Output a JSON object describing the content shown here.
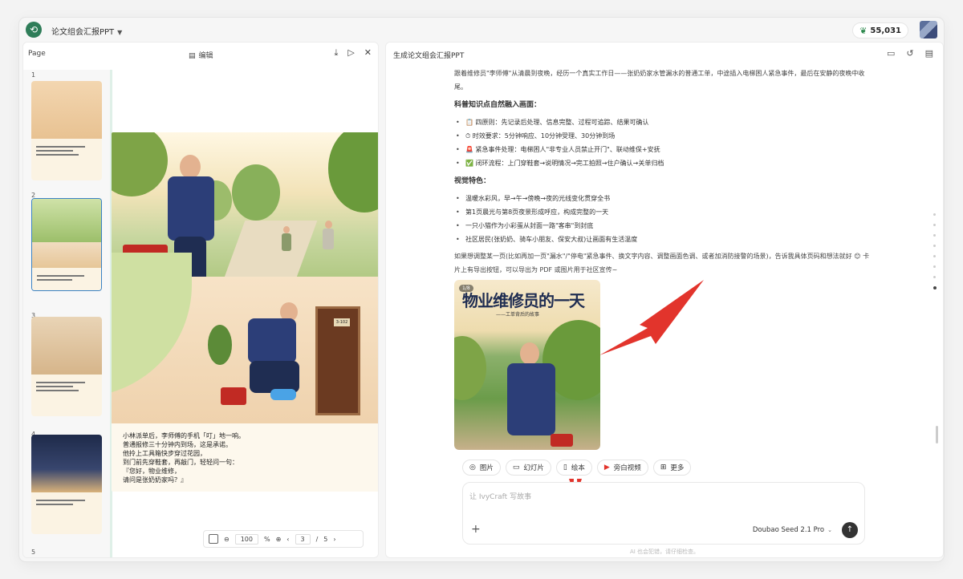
{
  "topbar": {
    "doc_name": "论文组会汇报PPT",
    "credits": "55,031"
  },
  "left": {
    "page_label": "Page",
    "edit_label": "编辑",
    "thumb_numbers": [
      "2",
      "3",
      "4",
      "5"
    ],
    "slide_text": [
      "小林派单后，李师傅的手机「叮」地一响。",
      "普通报修三十分钟内到场，这是承诺。",
      "他拎上工具箱快步穿过花园，",
      "到门前先穿鞋套，再敲门，轻轻问一句：",
      "『您好，物业维修，",
      "请问是张奶奶家吗？』"
    ],
    "door_plate": "3-102",
    "zoom": {
      "value": "100",
      "unit": "%",
      "current_page": "3",
      "separator": "/",
      "total_pages": "5"
    }
  },
  "right": {
    "title": "生成论文组会汇报PPT",
    "intro": "跟着维修员\"李师傅\"从清晨到夜晚，经历一个真实工作日——张奶奶家水管漏水的普通工单，中途插入电梯困人紧急事件，最后在安静的夜晚中收尾。",
    "section1_title": "科普知识点自然融入画面：",
    "section1_items": [
      "📋 四原则：先记录后处理、信息完整、过程可追踪、结果可确认",
      "⏱ 时效要求：5分钟响应、10分钟受理、30分钟到场",
      "🚨 紧急事件处理：电梯困人\"非专业人员禁止开门\"、联动维保+安抚",
      "✅ 闭环流程：上门穿鞋套→说明情况→完工拍照→住户确认→关单归档"
    ],
    "section2_title": "视觉特色：",
    "section2_items": [
      "温暖水彩风，早→午→傍晚→夜的光线变化贯穿全书",
      "第1页晨光与第8页夜景形成呼应，构成完整的一天",
      "一只小猫作为小彩蛋从封面一路\"客串\"到封底",
      "社区居民(张奶奶、骑车小朋友、保安大叔)让画面有生活温度"
    ],
    "outro": "如果想调整某一页(比如再加一页\"漏水\"/\"停电\"紧急事件、换文字内容、调整画面色调、或者加消防接警的场景)，告诉我具体页码和想法就好 😊 卡片上有导出按钮，可以导出为 PDF 或图片用于社区宣传~",
    "cover": {
      "badge": "1/8",
      "title": "物业维修员的一天",
      "subtitle": "——工单背后的故事"
    },
    "chips": [
      {
        "icon": "image-icon",
        "label": "图片"
      },
      {
        "icon": "slides-icon",
        "label": "幻灯片"
      },
      {
        "icon": "book-icon",
        "label": "绘本"
      },
      {
        "icon": "video-icon",
        "label": "旁白视频"
      },
      {
        "icon": "grid-icon",
        "label": "更多"
      }
    ],
    "input_placeholder": "让 IvyCraft 写故事",
    "model": "Doubao Seed 2.1 Pro",
    "disclaimer": "AI 也会犯错，请仔细检查。"
  },
  "colors": {
    "brand": "#2f7d59",
    "annotation_arrow": "#e2342c"
  }
}
